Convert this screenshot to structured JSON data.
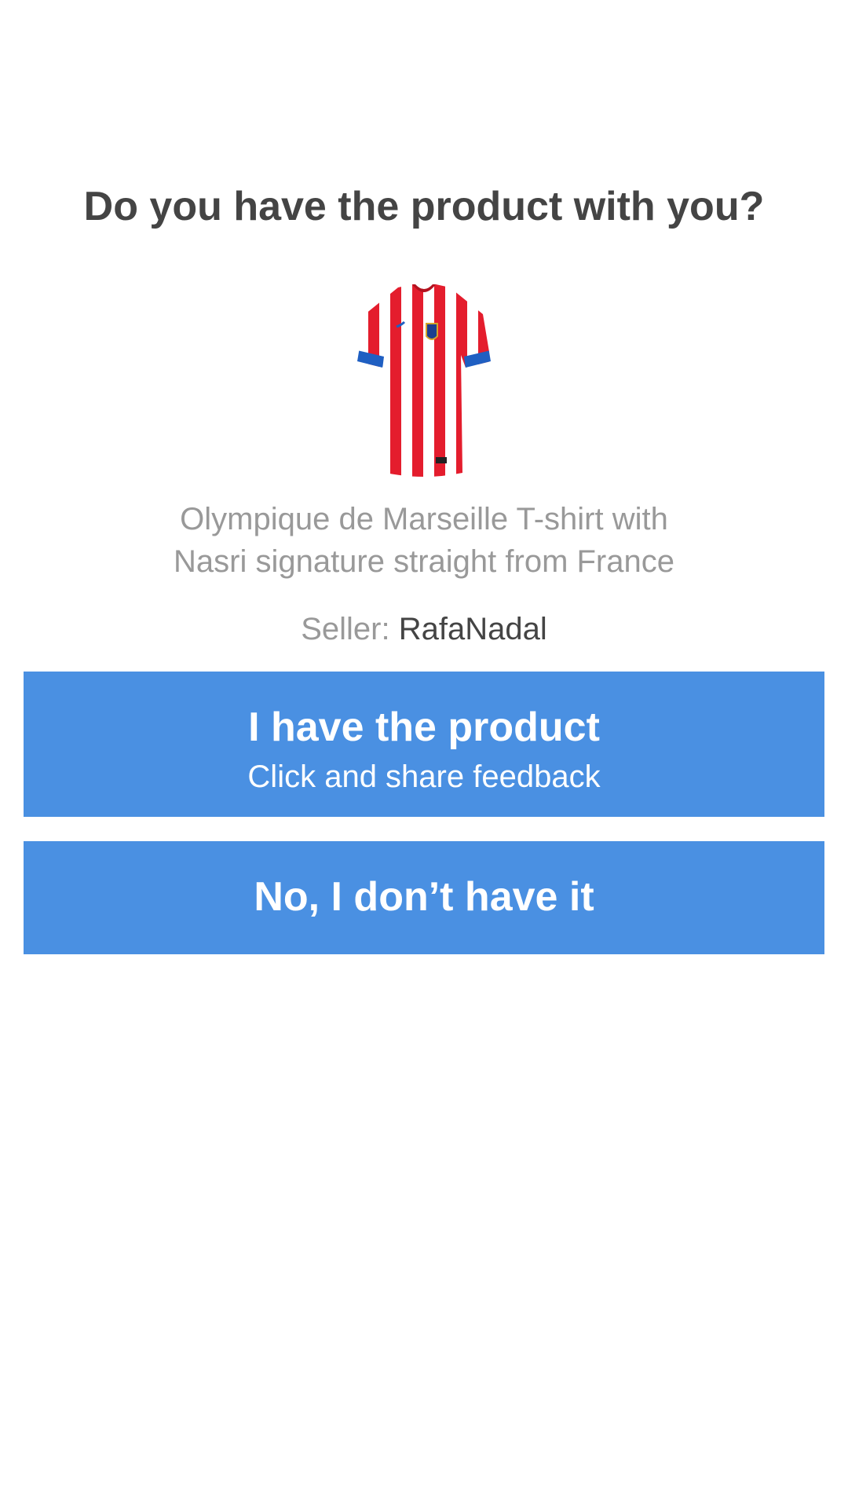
{
  "title": "Do you have the product with you?",
  "product": {
    "image_icon": "red-white-striped-jersey-icon",
    "description_line1": "Olympique de Marseille T-shirt with",
    "description_line2": "Nasri signature straight from France",
    "seller_label": "Seller:",
    "seller_name": "RafaNadal"
  },
  "buttons": {
    "have_product_label": "I have the product",
    "have_product_sublabel": "Click and share feedback",
    "dont_have_label": "No, I don’t have it"
  },
  "colors": {
    "accent": "#4a90e2",
    "title_text": "#444444",
    "muted_text": "#999999",
    "background": "#ffffff"
  }
}
